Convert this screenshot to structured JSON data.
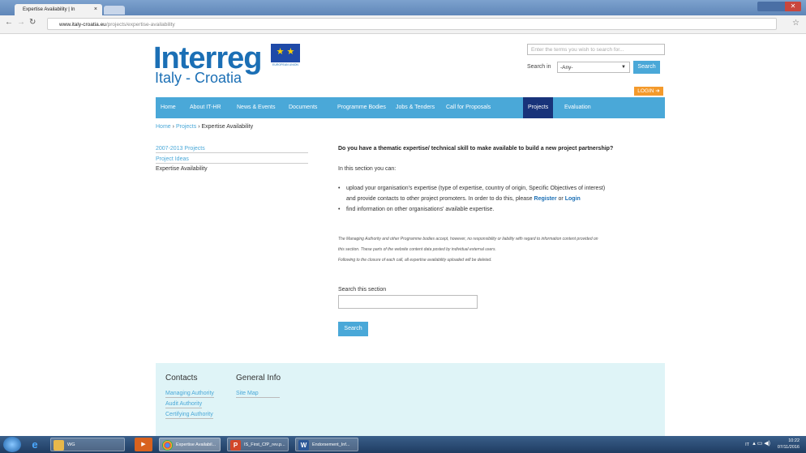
{
  "browser": {
    "tab_title": "Expertise Availability | In",
    "tab_close": "×",
    "url_host": "www.italy-croatia.eu",
    "url_path": "/projects/expertise-availability"
  },
  "logo": {
    "main": "Interreg",
    "sub": "Italy - Croatia",
    "eu_caption": "EUROPEAN UNION"
  },
  "header_search": {
    "placeholder": "Enter the terms you wish to search for...",
    "search_in_label": "Search in",
    "select_value": "-Any-",
    "button": "Search"
  },
  "login": "LOGIN",
  "nav": [
    "Home",
    "About IT-HR",
    "News & Events",
    "Documents",
    "Programme Bodies",
    "Jobs & Tenders",
    "Call for Proposals",
    "Projects",
    "Evaluation"
  ],
  "breadcrumb": {
    "home": "Home",
    "sep1": "›",
    "projects": "Projects",
    "sep2": "›",
    "current": "Expertise Availability"
  },
  "sidebar": [
    "2007-2013 Projects",
    "Project Ideas",
    "Expertise Availability"
  ],
  "content": {
    "question": "Do you have a thematic expertise/ technical skill to make available to build a new project partnership?",
    "intro": "In this section you can:",
    "bullet1_line1": "upload your organisation's expertise (type of expertise, country of origin, Specific Objectives of interest)",
    "bullet1_line2_pre": "and provide contacts to other project promoters. In order to do this, please",
    "register": "Register",
    "or": "or",
    "login": "Login",
    "bullet2": "find information on other organisations' available expertise.",
    "disclaimer1": "The Managing Authority and other Programme bodies accept, however, no responsibility or liability with regard to information content provided on",
    "disclaimer2": "this section. These parts of the website content data posted by individual external users.",
    "disclaimer3": "Following to the closure of each call, all expertise availability uploaded will be deleted.",
    "search_label": "Search this section",
    "search_button": "Search"
  },
  "footer": {
    "contacts_title": "Contacts",
    "contacts": [
      "Managing Authority",
      "Audit Authority",
      "Certifying Authority"
    ],
    "general_title": "General Info",
    "general": [
      "Site Map"
    ]
  },
  "taskbar": {
    "items": [
      {
        "label": "WG",
        "icon": "folder-icon"
      },
      {
        "label": "Expertise Availabil...",
        "icon": "chrome-icon"
      },
      {
        "label": "IS_First_CfP_rev.p...",
        "icon": "powerpoint-icon"
      },
      {
        "label": "Endorsement_Inf...",
        "icon": "word-icon"
      }
    ],
    "lang": "IT",
    "time": "10:22",
    "date": "07/11/2016"
  },
  "colors": {
    "brand_blue": "#1b6fb5",
    "nav_blue": "#4aa8d8",
    "active_nav": "#18337a",
    "login_orange": "#f49a2c",
    "footer_bg": "#dff4f7"
  }
}
